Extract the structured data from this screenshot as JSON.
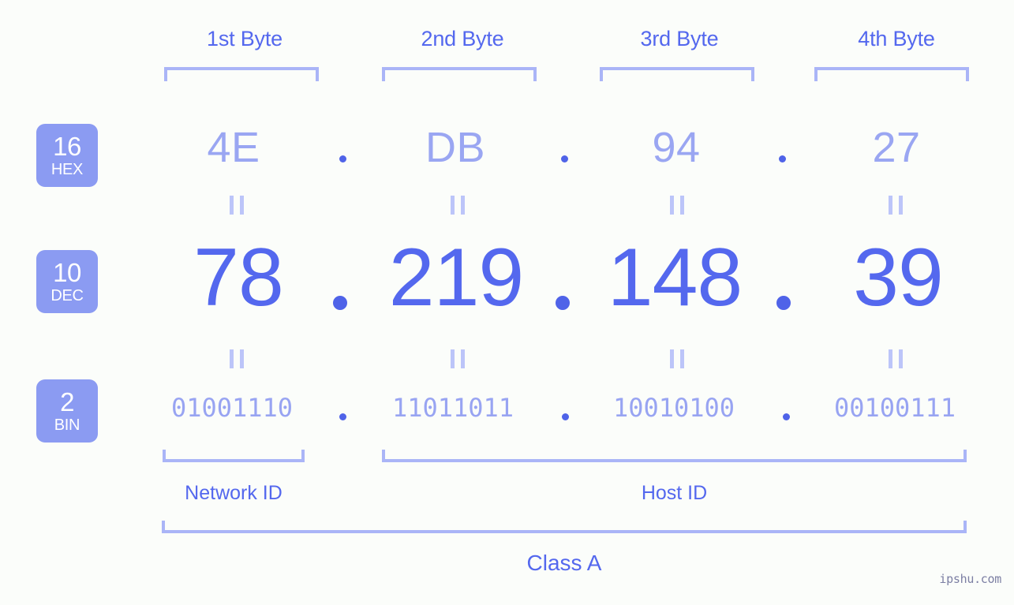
{
  "meta": {
    "watermark": "ipshu.com",
    "background_color": "#fbfdfa",
    "accent_strong": "#5468ee",
    "accent_light": "#9aa6f2",
    "badge_color": "#8b9bf2",
    "bracket_color": "#aab5f7"
  },
  "byte_headers": [
    {
      "label": "1st Byte"
    },
    {
      "label": "2nd Byte"
    },
    {
      "label": "3rd Byte"
    },
    {
      "label": "4th Byte"
    }
  ],
  "bases": [
    {
      "radix": "16",
      "name": "HEX"
    },
    {
      "radix": "10",
      "name": "DEC"
    },
    {
      "radix": "2",
      "name": "BIN"
    }
  ],
  "rows": {
    "hex": {
      "values": [
        "4E",
        "DB",
        "94",
        "27"
      ],
      "separators": [
        ".",
        ".",
        "."
      ]
    },
    "dec": {
      "values": [
        "78",
        "219",
        "148",
        "39"
      ],
      "separators": [
        ".",
        ".",
        "."
      ]
    },
    "bin": {
      "values": [
        "01001110",
        "11011011",
        "10010100",
        "00100111"
      ],
      "separators": [
        ".",
        ".",
        "."
      ]
    }
  },
  "sections": [
    {
      "label": "Network ID"
    },
    {
      "label": "Host ID"
    }
  ],
  "class": {
    "label": "Class A"
  },
  "chart_data": {
    "type": "table",
    "title": "IP Address 78.219.148.39 byte breakdown",
    "categories": [
      "1st Byte",
      "2nd Byte",
      "3rd Byte",
      "4th Byte"
    ],
    "series": [
      {
        "name": "HEX",
        "values": [
          "4E",
          "DB",
          "94",
          "27"
        ]
      },
      {
        "name": "DEC",
        "values": [
          78,
          219,
          148,
          39
        ]
      },
      {
        "name": "BIN",
        "values": [
          "01001110",
          "11011011",
          "10010100",
          "00100111"
        ]
      }
    ],
    "annotations": [
      {
        "text": "Network ID",
        "spans": [
          "1st Byte"
        ]
      },
      {
        "text": "Host ID",
        "spans": [
          "2nd Byte",
          "3rd Byte",
          "4th Byte"
        ]
      },
      {
        "text": "Class A",
        "spans": [
          "1st Byte",
          "2nd Byte",
          "3rd Byte",
          "4th Byte"
        ]
      }
    ]
  }
}
